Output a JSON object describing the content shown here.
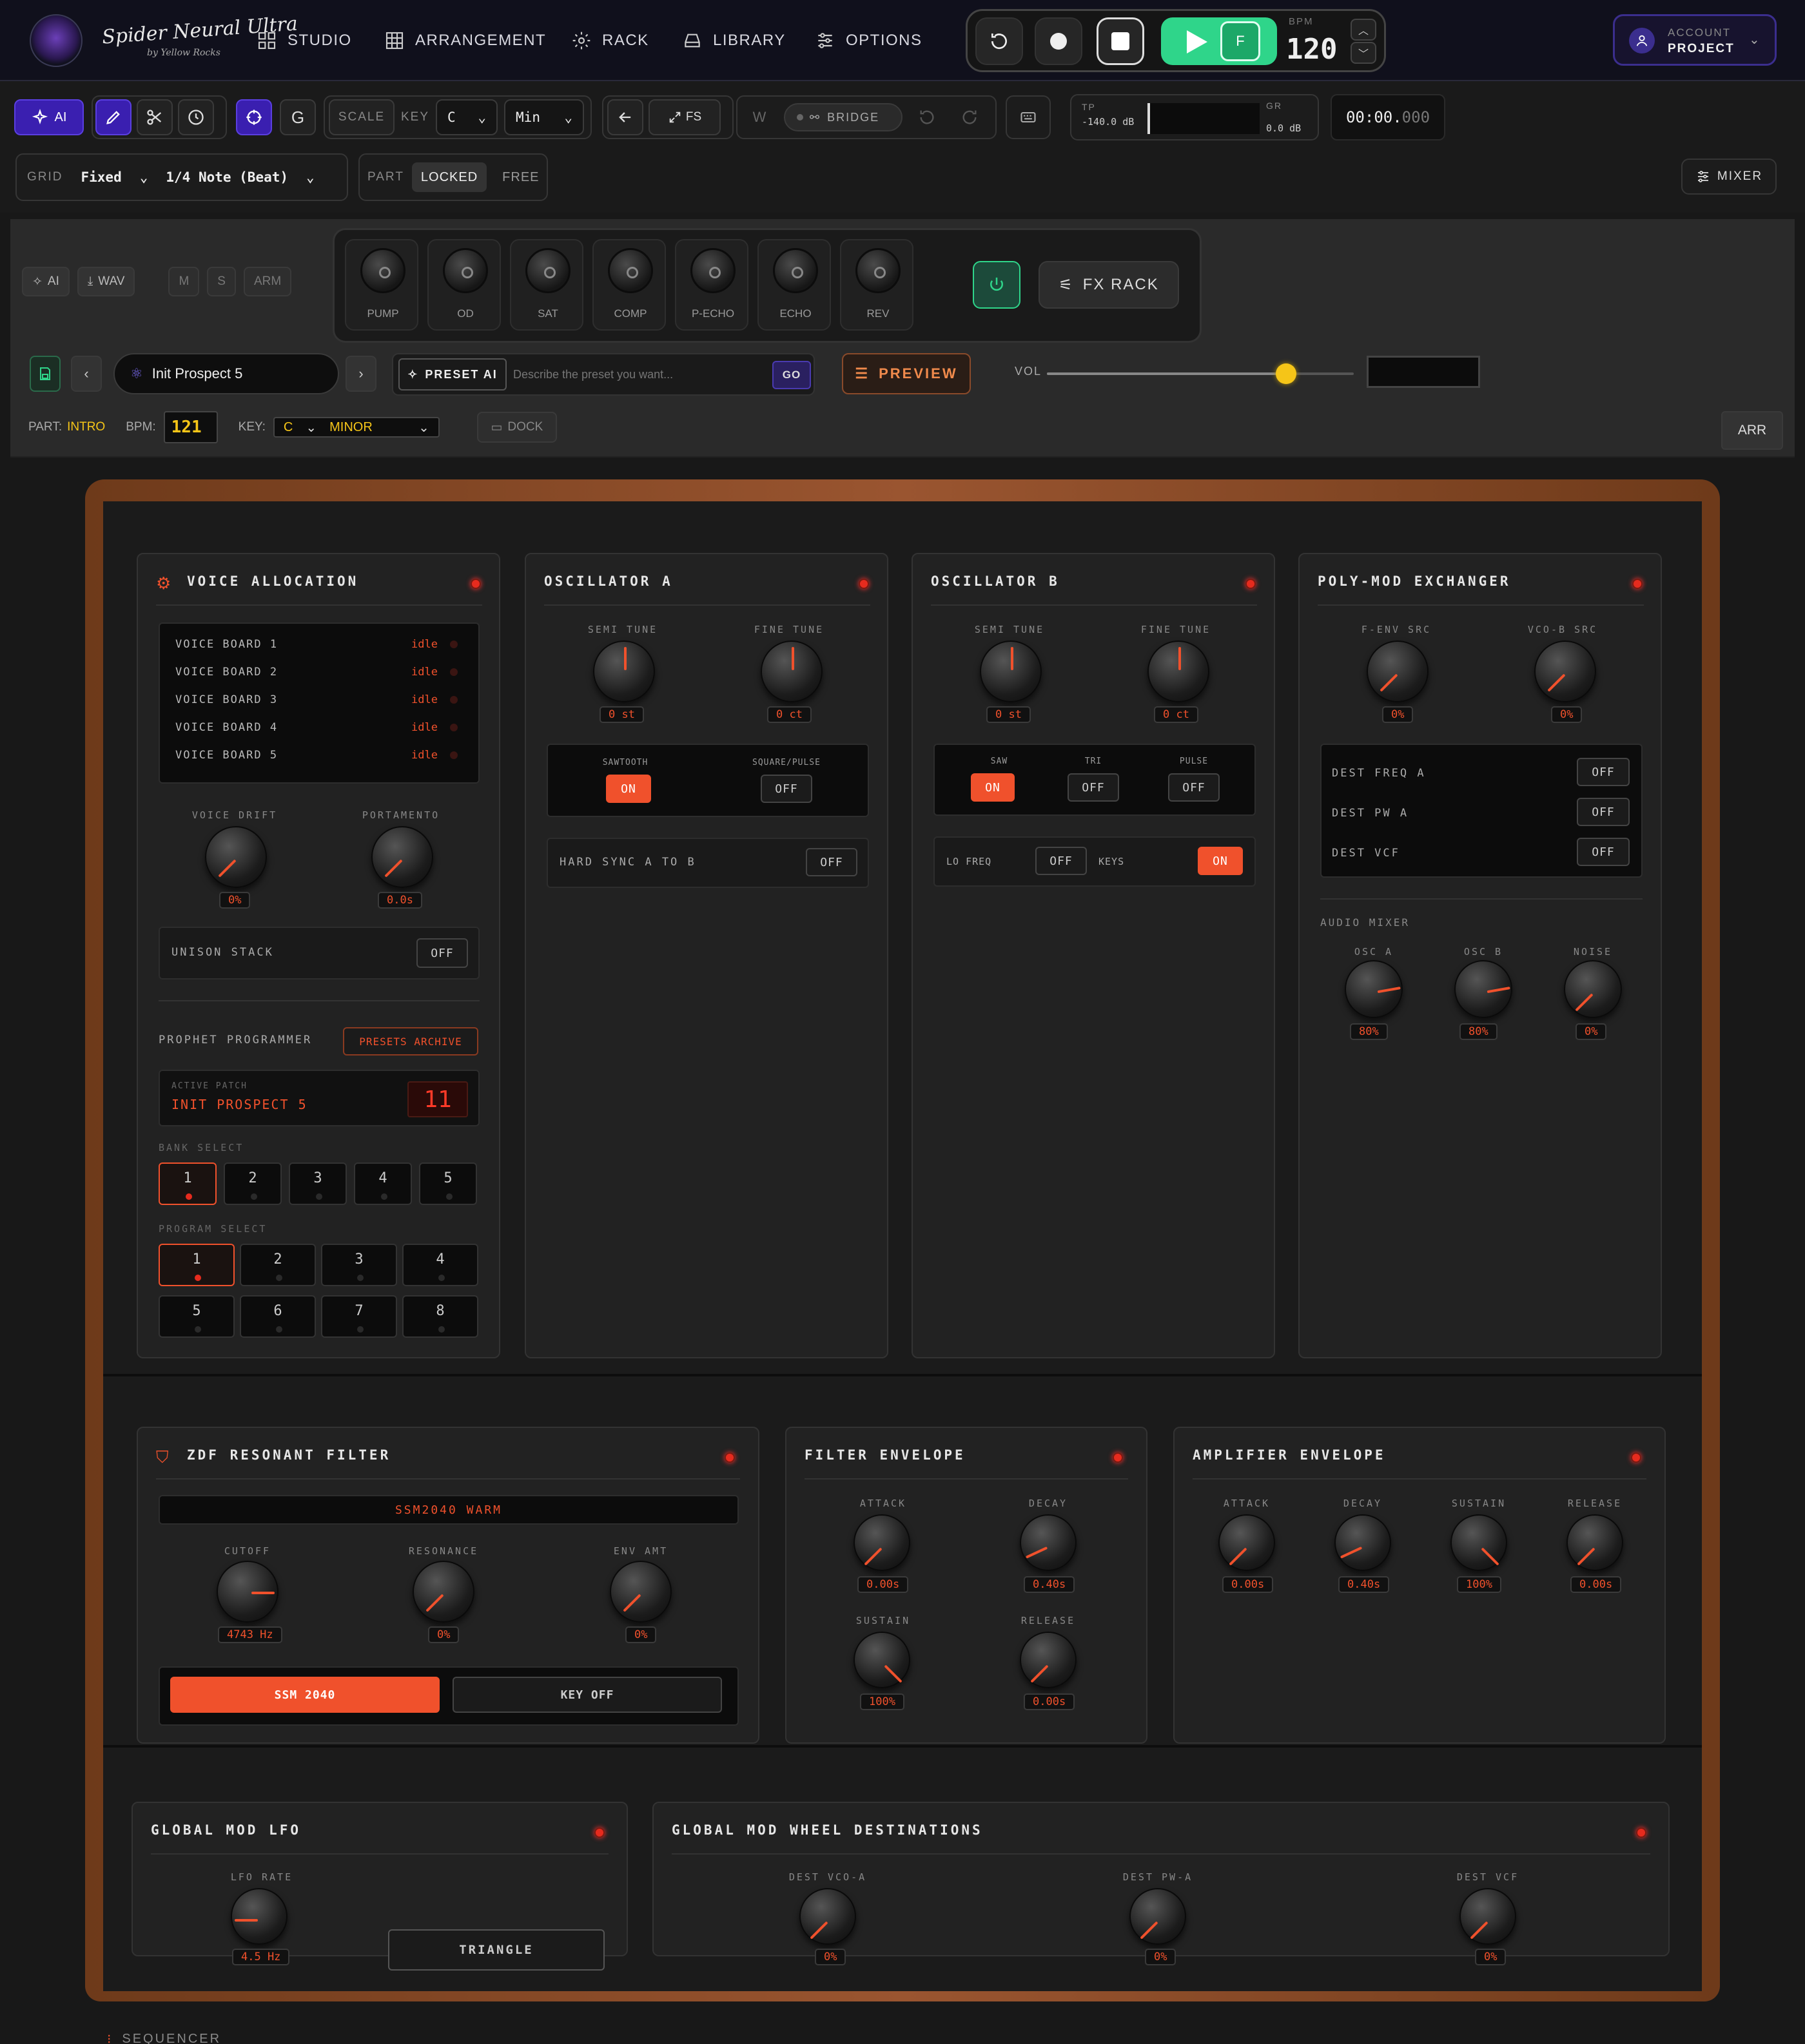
{
  "nav": {
    "studio": "STUDIO",
    "arrangement": "ARRANGEMENT",
    "rack": "RACK",
    "library": "LIBRARY",
    "options": "OPTIONS"
  },
  "transport": {
    "f_label": "F",
    "bpm_label": "BPM",
    "bpm": "120"
  },
  "account": {
    "line1": "ACCOUNT",
    "line2": "PROJECT"
  },
  "toolbar": {
    "ai": "AI",
    "g": "G",
    "scale": "SCALE",
    "key_label": "KEY",
    "key": "C",
    "mode": "Min",
    "fs": "FS",
    "w": "W",
    "bridge": "BRIDGE",
    "tp_label": "TP",
    "tp_value": "-140.0 dB",
    "gr_label": "GR",
    "gr_value": "0.0 dB",
    "time_main": "00:00.",
    "time_ms": "000"
  },
  "row2": {
    "grid_label": "GRID",
    "grid": "Fixed",
    "note": "1/4 Note (Beat)",
    "part_label": "PART",
    "locked": "LOCKED",
    "free": "FREE",
    "mixer": "MIXER"
  },
  "track": {
    "ai": "AI",
    "wav": "WAV",
    "m": "M",
    "s": "S",
    "arm": "ARM",
    "fx": [
      "PUMP",
      "OD",
      "SAT",
      "COMP",
      "P-ECHO",
      "ECHO",
      "REV"
    ],
    "fx_rack": "FX RACK",
    "preset": "Init Prospect 5",
    "preset_ai": "PRESET AI",
    "preset_placeholder": "Describe the preset you want...",
    "go": "GO",
    "preview": "PREVIEW",
    "vol": "VOL",
    "vol_level": 0.78,
    "part_label": "PART:",
    "part": "INTRO",
    "bpm_label": "BPM:",
    "bpm": "121",
    "key_label": "KEY:",
    "key": "C",
    "mode": "MINOR",
    "dock": "DOCK",
    "arr": "ARR"
  },
  "voice": {
    "title": "VOICE ALLOCATION",
    "boards": [
      {
        "name": "VOICE BOARD 1",
        "state": "idle"
      },
      {
        "name": "VOICE BOARD 2",
        "state": "idle"
      },
      {
        "name": "VOICE BOARD 3",
        "state": "idle"
      },
      {
        "name": "VOICE BOARD 4",
        "state": "idle"
      },
      {
        "name": "VOICE BOARD 5",
        "state": "idle"
      }
    ],
    "drift_label": "VOICE DRIFT",
    "drift": "0%",
    "porta_label": "PORTAMENTO",
    "porta": "0.0s",
    "unison_label": "UNISON STACK",
    "unison": "OFF",
    "programmer": "PROPHET PROGRAMMER",
    "archive": "PRESETS ARCHIVE",
    "active_label": "ACTIVE PATCH",
    "active_patch": "INIT PROSPECT 5",
    "patch_num": "11",
    "bank_label": "BANK SELECT",
    "banks": [
      "1",
      "2",
      "3",
      "4",
      "5"
    ],
    "program_label": "PROGRAM SELECT",
    "programs": [
      "1",
      "2",
      "3",
      "4",
      "5",
      "6",
      "7",
      "8"
    ]
  },
  "oscA": {
    "title": "OSCILLATOR A",
    "semi_label": "SEMI TUNE",
    "semi": "0 st",
    "fine_label": "FINE TUNE",
    "fine": "0 ct",
    "saw_label": "SAWTOOTH",
    "saw": "ON",
    "sq_label": "SQUARE/PULSE",
    "sq": "OFF",
    "sync_label": "HARD SYNC A TO B",
    "sync": "OFF"
  },
  "oscB": {
    "title": "OSCILLATOR B",
    "semi_label": "SEMI TUNE",
    "semi": "0 st",
    "fine_label": "FINE TUNE",
    "fine": "0 ct",
    "saw_label": "SAW",
    "saw": "ON",
    "tri_label": "TRI",
    "tri": "OFF",
    "pulse_label": "PULSE",
    "pulse": "OFF",
    "lo_label": "LO FREQ",
    "lo": "OFF",
    "keys_label": "KEYS",
    "keys": "ON"
  },
  "polymod": {
    "title": "POLY-MOD EXCHANGER",
    "fenv_label": "F-ENV SRC",
    "fenv": "0%",
    "vcob_label": "VCO-B SRC",
    "vcob": "0%",
    "dests": [
      {
        "name": "DEST FREQ A",
        "val": "OFF"
      },
      {
        "name": "DEST PW A",
        "val": "OFF"
      },
      {
        "name": "DEST VCF",
        "val": "OFF"
      }
    ],
    "mixer_label": "AUDIO MIXER",
    "osca_label": "OSC A",
    "osca": "80%",
    "oscb_label": "OSC B",
    "oscb": "80%",
    "noise_label": "NOISE",
    "noise": "0%"
  },
  "filter": {
    "title": "ZDF RESONANT FILTER",
    "model": "SSM2040 WARM",
    "cutoff_label": "CUTOFF",
    "cutoff": "4743 Hz",
    "res_label": "RESONANCE",
    "res": "0%",
    "env_label": "ENV AMT",
    "env": "0%",
    "ssm": "SSM 2040",
    "key": "KEY OFF"
  },
  "fenv": {
    "title": "FILTER ENVELOPE",
    "attack_label": "ATTACK",
    "attack": "0.00s",
    "decay_label": "DECAY",
    "decay": "0.40s",
    "sustain_label": "SUSTAIN",
    "sustain": "100%",
    "release_label": "RELEASE",
    "release": "0.00s"
  },
  "aenv": {
    "title": "AMPLIFIER ENVELOPE",
    "attack_label": "ATTACK",
    "attack": "0.00s",
    "decay_label": "DECAY",
    "decay": "0.40s",
    "sustain_label": "SUSTAIN",
    "sustain": "100%",
    "release_label": "RELEASE",
    "release": "0.00s"
  },
  "lfo": {
    "title": "GLOBAL MOD LFO",
    "rate_label": "LFO RATE",
    "rate": "4.5 Hz",
    "wave": "TRIANGLE"
  },
  "wheel": {
    "title": "GLOBAL MOD WHEEL DESTINATIONS",
    "vcoa_label": "DEST VCO-A",
    "vcoa": "0%",
    "pwa_label": "DEST PW-A",
    "pwa": "0%",
    "vcf_label": "DEST VCF",
    "vcf": "0%"
  },
  "footer": {
    "sequencer": "SEQUENCER"
  },
  "colors": {
    "accent": "#f0512c",
    "led": "#e62b1e",
    "play": "#2fd58a",
    "brand": "#3b2e8e",
    "wood": "#9a5530",
    "knob_yellow": "#f5c518"
  }
}
